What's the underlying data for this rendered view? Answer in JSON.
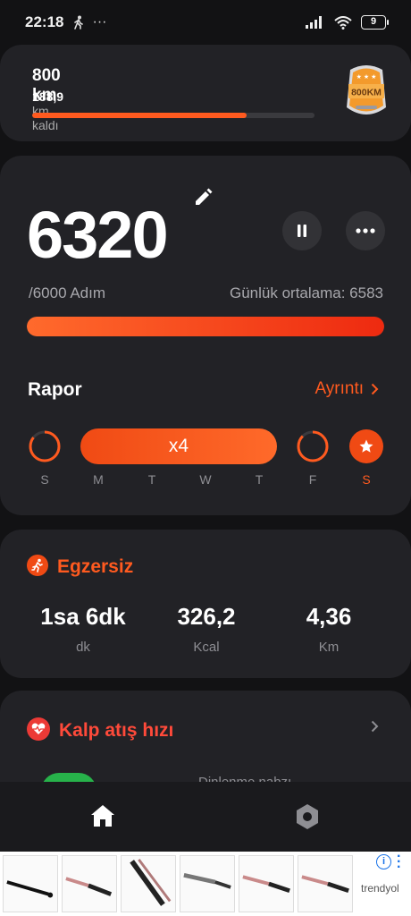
{
  "status_bar": {
    "time": "22:18",
    "battery": "9"
  },
  "goal_card": {
    "title": "800 km",
    "remaining_value": "188,9",
    "remaining_label": "km kaldı",
    "progress": 0.76,
    "badge_text": "800KM"
  },
  "steps_card": {
    "steps": "6320",
    "goal_text": "/6000 Adım",
    "average_text": "Günlük ortalama: 6583",
    "progress": 1.0,
    "report_label": "Rapor",
    "details_label": "Ayrıntı",
    "streak_label": "x4",
    "days": [
      "S",
      "M",
      "T",
      "W",
      "T",
      "F",
      "S"
    ],
    "active_day_index": 6
  },
  "exercise_card": {
    "title": "Egzersiz",
    "stats": [
      {
        "value": "1sa 6dk",
        "unit": "dk"
      },
      {
        "value": "326,2",
        "unit": "Kcal"
      },
      {
        "value": "4,36",
        "unit": "Km"
      }
    ]
  },
  "heart_card": {
    "title": "Kalp atış hızı",
    "subtitle": "Dinlenme nabzı"
  },
  "bottom_nav": {
    "items": [
      "home-icon",
      "settings-icon"
    ]
  },
  "ad": {
    "brand": "trendyol",
    "info": "i"
  },
  "colors": {
    "accent": "#ff5a1f",
    "heart": "#ec3a36",
    "background": "#121214",
    "card": "#222226"
  }
}
